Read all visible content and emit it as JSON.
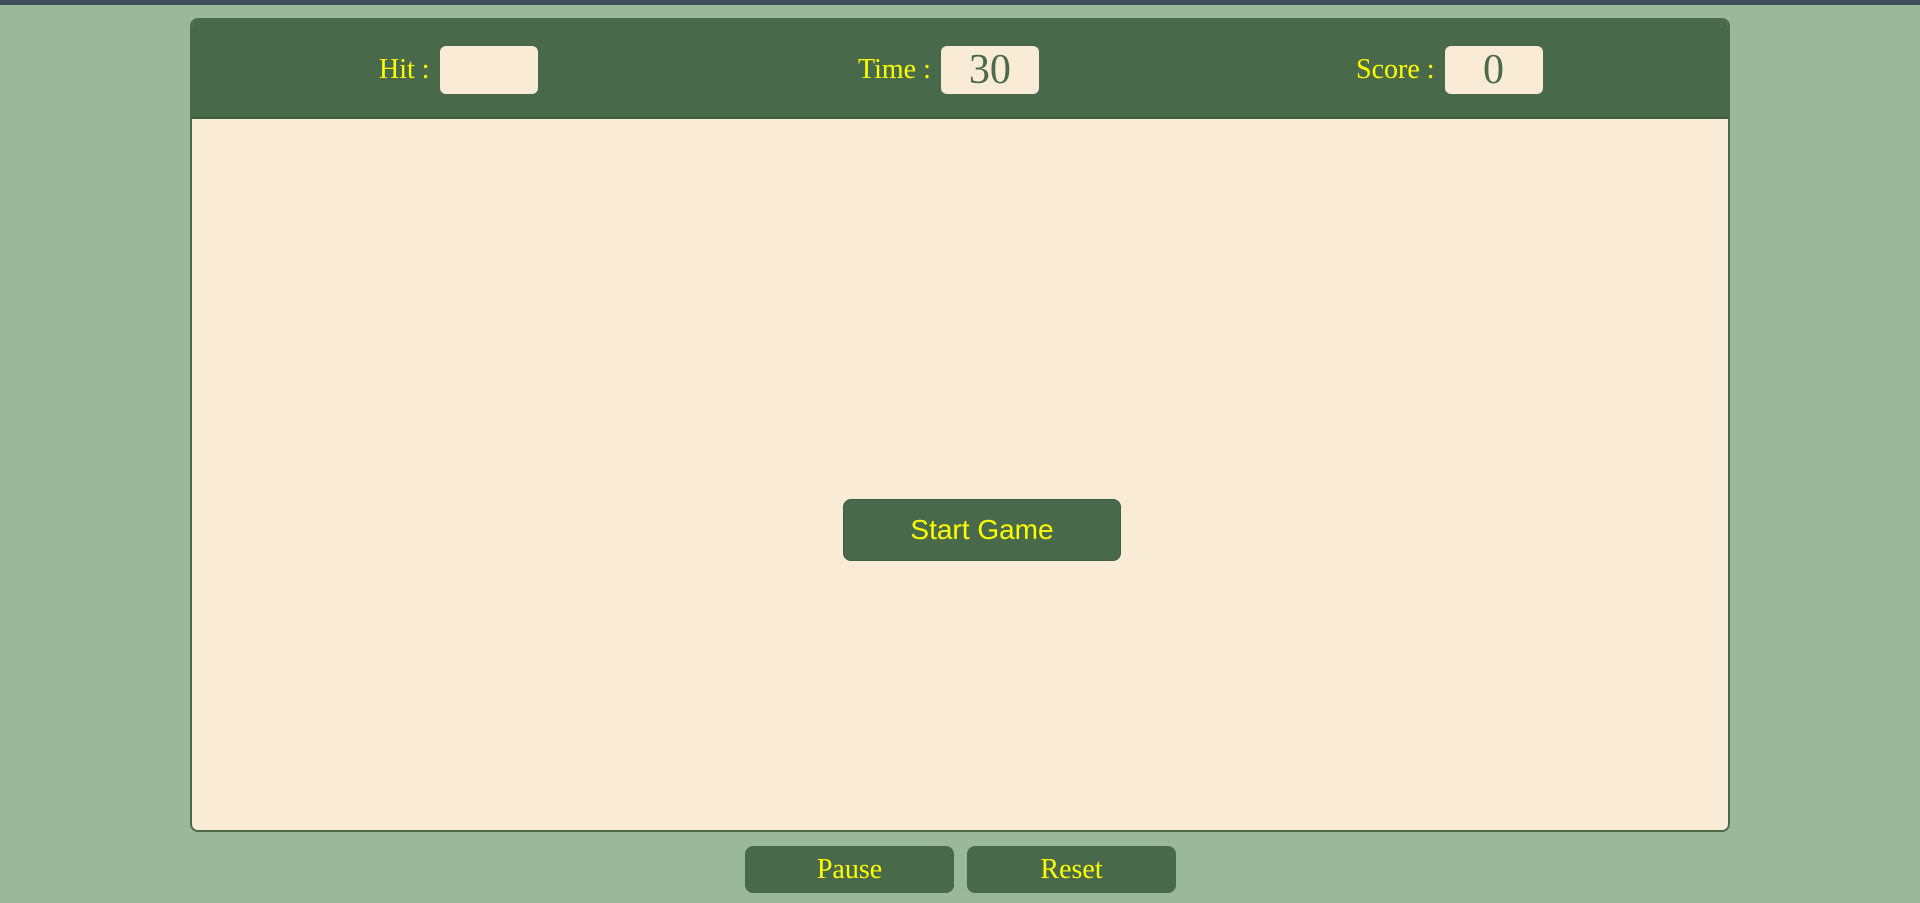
{
  "scoreboard": {
    "hit": {
      "label": "Hit :",
      "value": ""
    },
    "time": {
      "label": "Time :",
      "value": "30"
    },
    "score": {
      "label": "Score :",
      "value": "0"
    }
  },
  "game_area": {
    "start_button_label": "Start Game"
  },
  "controls": {
    "pause_label": "Pause",
    "reset_label": "Reset"
  },
  "colors": {
    "page_background": "#9bb99a",
    "panel_green": "#496a4a",
    "board_background": "#faebd7",
    "label_yellow": "#ffff00",
    "value_green": "#4a6a4a"
  }
}
